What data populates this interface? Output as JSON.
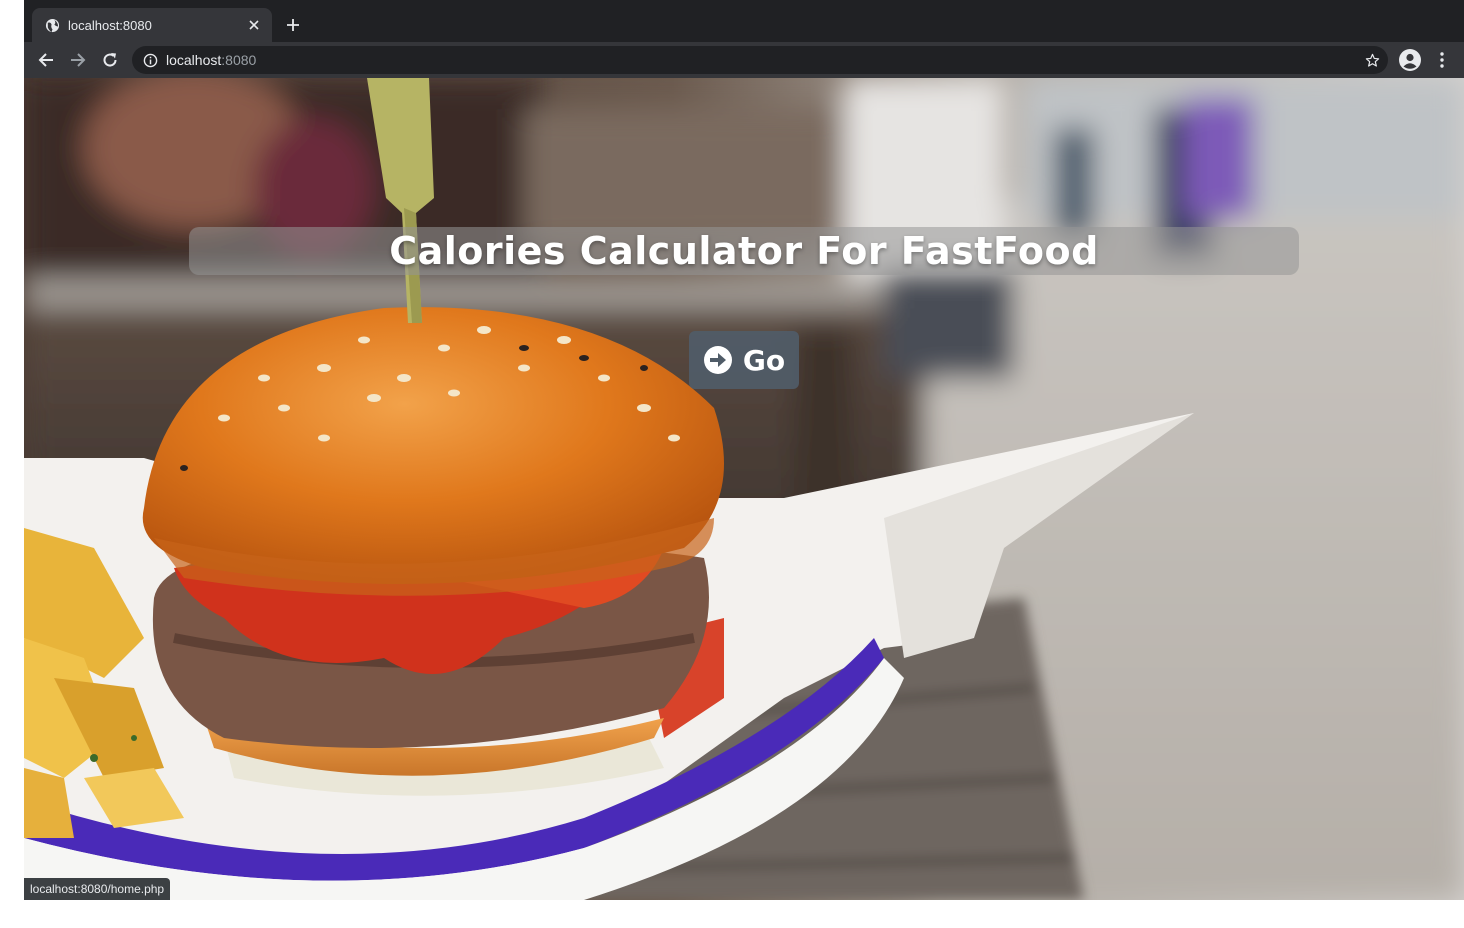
{
  "browser": {
    "tab": {
      "title": "localhost:8080"
    },
    "address_bar": {
      "host": "localhost",
      "port": ":8080"
    },
    "status_url": "localhost:8080/home.php"
  },
  "page": {
    "title": "Calories Calculator For FastFood",
    "go_button_label": "Go",
    "background_image": "burger-and-fries-photo"
  },
  "colors": {
    "tabstrip": "#202124",
    "toolbar": "#35363a",
    "banner": "#969696",
    "go_button": "#505c68"
  }
}
